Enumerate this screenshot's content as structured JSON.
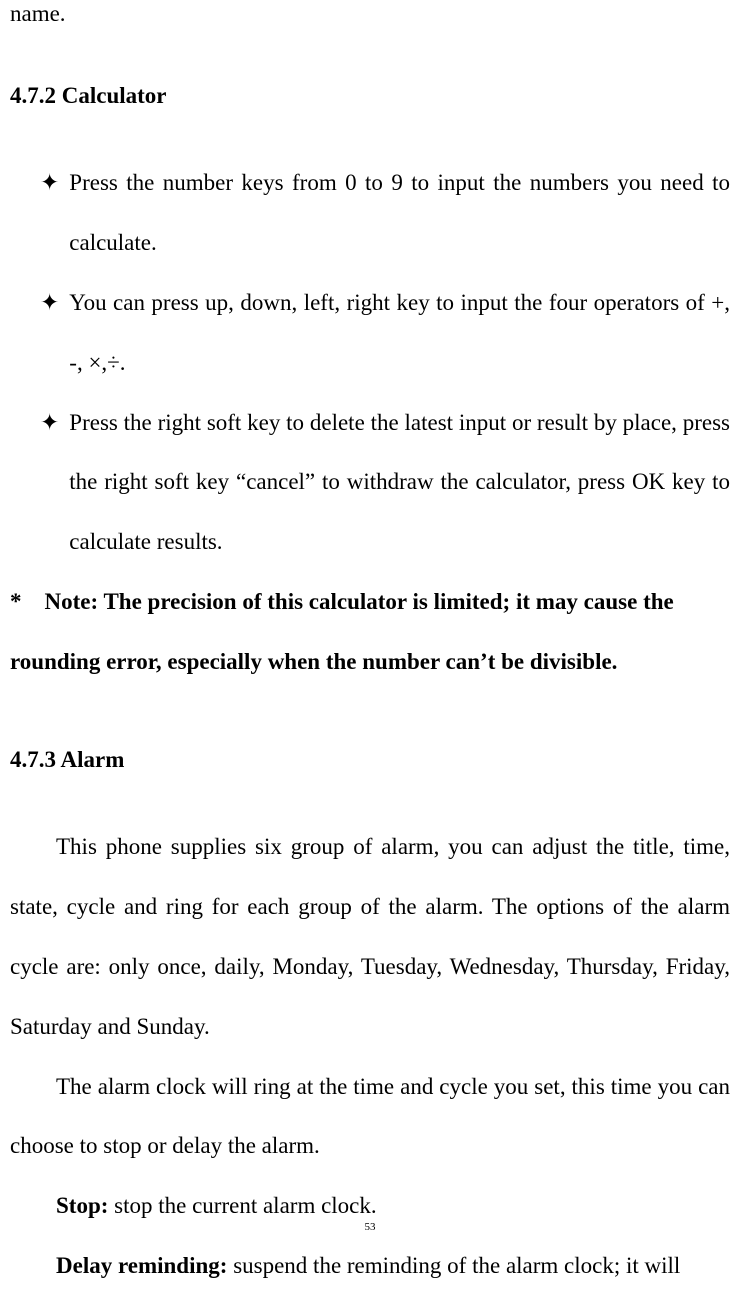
{
  "top_fragment": "name.",
  "section1": {
    "heading": "4.7.2 Calculator",
    "bullets": [
      "Press the number keys from 0 to 9 to input the numbers you need to calculate.",
      "You can press up, down, left, right key to input the four operators of +, -, ×,÷.",
      "Press the right soft key to delete the latest input or result by place, press the right soft key “cancel” to withdraw the calculator, press OK key to calculate results."
    ],
    "note_line1": "* Note: The precision of this calculator is limited; it may cause the",
    "note_line2": "rounding error, especially when the number can’t be divisible."
  },
  "section2": {
    "heading": "4.7.3 Alarm",
    "para1": "This phone supplies six group of alarm, you can adjust the title, time, state, cycle and ring for each group of the alarm. The options of the alarm cycle are: only once, daily, Monday, Tuesday, Wednesday, Thursday, Friday, Saturday and Sunday.",
    "para2": "The alarm clock will ring at the time and cycle you set, this time you can choose to stop or delay the alarm.",
    "option1_label": "Stop: ",
    "option1_text": "stop the current alarm clock.",
    "option2_label": "Delay reminding: ",
    "option2_text": "suspend the reminding of the alarm clock; it will"
  },
  "page_number": "53",
  "glyphs": {
    "diamond": "✦"
  }
}
